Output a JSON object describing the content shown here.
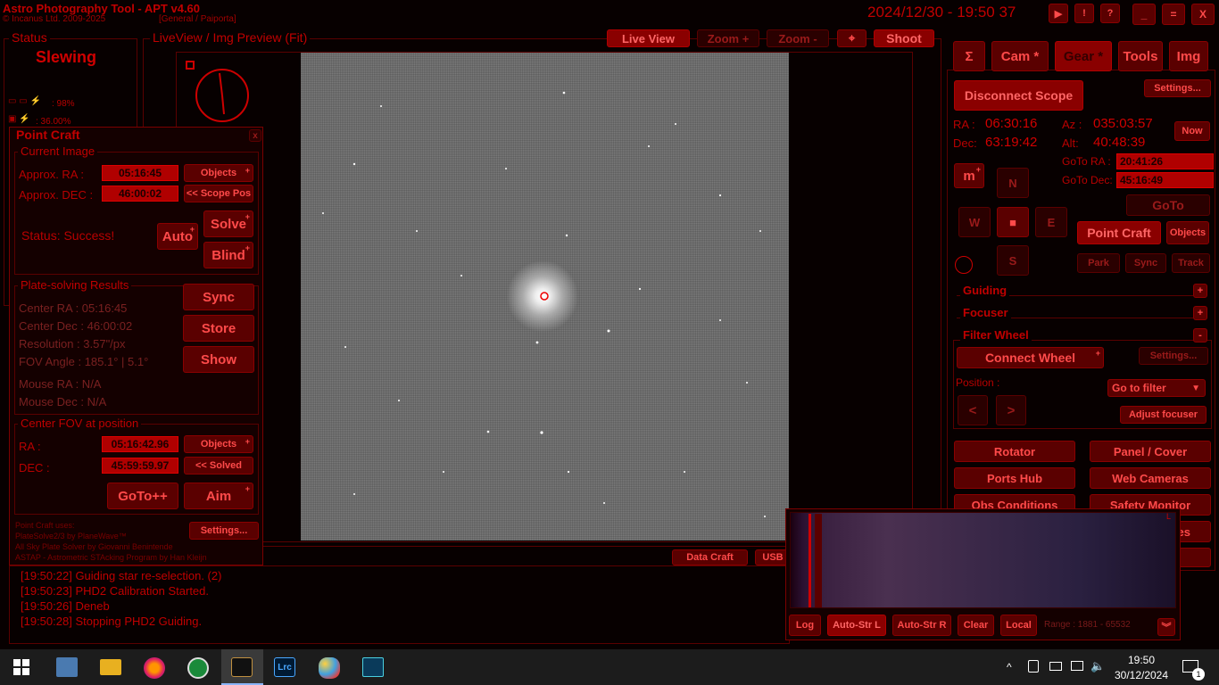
{
  "app": {
    "title": "Astro Photography Tool  -  APT v4.60",
    "copyright": "© Incanus Ltd. 2009-2025",
    "profile": "[General / Paiporta]",
    "datetime": "2024/12/30 - 19:50 37",
    "win_buttons": [
      "▶",
      "!",
      "?",
      "_",
      "=",
      "X"
    ]
  },
  "status": {
    "title": "Status",
    "value": "Slewing",
    "battery1": ": 98%",
    "battery2": ": 36.00%"
  },
  "liveview": {
    "title": "LiveView / Img Preview (Fit)",
    "buttons": {
      "live": "Live View",
      "zoom_in": "Zoom +",
      "zoom_out": "Zoom -",
      "shoot": "Shoot"
    }
  },
  "pointcraft": {
    "title": "Point Craft",
    "close": "x",
    "current_image": {
      "title": "Current Image",
      "approx_ra_label": "Approx. RA :",
      "approx_ra": "05:16:45",
      "approx_dec_label": "Approx. DEC :",
      "approx_dec": "46:00:02",
      "objects": "Objects",
      "scope_pos": "<< Scope Pos",
      "status": "Status: Success!",
      "auto": "Auto",
      "solve": "Solve",
      "blind": "Blind"
    },
    "results": {
      "title": "Plate-solving Results",
      "center_ra": "Center RA :     05:16:45",
      "center_dec": "Center Dec :   46:00:02",
      "resolution": "Resolution : 3.57\"/px",
      "fov": "FOV Angle : 185.1° | 5.1°",
      "mouse_ra": "Mouse RA :      N/A",
      "mouse_dec": "Mouse Dec :    N/A",
      "sync": "Sync",
      "store": "Store",
      "show": "Show"
    },
    "center_fov": {
      "title": "Center FOV at position",
      "ra_label": "RA :",
      "ra": "05:16:42.96",
      "dec_label": "DEC :",
      "dec": "45:59:59.97",
      "objects": "Objects",
      "solved": "<< Solved",
      "goto": "GoTo++",
      "aim": "Aim"
    },
    "credits": [
      "Point Craft uses:",
      "PlateSolve2/3 by PlaneWave™",
      "All Sky Plate Solver by Giovanni Benintende",
      "ASTAP - Astrometric STAcking Program by Han Kleijn"
    ],
    "settings": "Settings..."
  },
  "log": {
    "data_craft": "Data Craft",
    "usb": "USB",
    "lines": [
      "[19:50:22] Guiding star re-selection. (2)",
      "[19:50:23] PHD2 Calibration Started.",
      "[19:50:26] Deneb",
      "[19:50:28] Stopping PHD2 Guiding."
    ]
  },
  "tabs": [
    "Σ",
    "Cam *",
    "Gear *",
    "Tools",
    "Img"
  ],
  "gear": {
    "disconnect": "Disconnect Scope",
    "settings": "Settings...",
    "ra_label": "RA :",
    "ra": "06:30:16",
    "dec_label": "Dec:",
    "dec": "63:19:42",
    "az_label": "Az :",
    "az": "035:03:57",
    "alt_label": "Alt:",
    "alt": "40:48:39",
    "now": "Now",
    "goto_ra_label": "GoTo RA :",
    "goto_ra": "20:41:26",
    "goto_dec_label": "GoTo Dec:",
    "goto_dec": "45:16:49",
    "m": "m",
    "n": "N",
    "s": "S",
    "e": "E",
    "w": "W",
    "goto": "GoTo",
    "point_craft": "Point Craft",
    "objects": "Objects",
    "park": "Park",
    "sync": "Sync",
    "track": "Track",
    "guiding": "Guiding",
    "focuser": "Focuser",
    "filter_wheel": "Filter Wheel",
    "connect_wheel": "Connect Wheel",
    "fw_settings": "Settings...",
    "position": "Position :",
    "go_to_filter": "Go to filter",
    "prev": "<",
    "next": ">",
    "adjust_focuser": "Adjust focuser",
    "rotator": "Rotator",
    "panel_cover": "Panel / Cover",
    "ports_hub": "Ports Hub",
    "web_cameras": "Web Cameras",
    "obs_conditions": "Obs Conditions",
    "safety_monitor": "Safety Monitor",
    "cut_es": "es"
  },
  "histogram": {
    "corner": "L",
    "buttons": [
      "Log",
      "Auto-Str L",
      "Auto-Str R",
      "Clear",
      "Local"
    ],
    "range": "Range : 1881 - 65532"
  },
  "taskbar": {
    "time": "19:50",
    "date": "30/12/2024",
    "lrc": "Lrc",
    "notif_count": "1"
  },
  "colors": {
    "accent": "#c00000",
    "button": "#5a0000",
    "bg": "#070000"
  }
}
